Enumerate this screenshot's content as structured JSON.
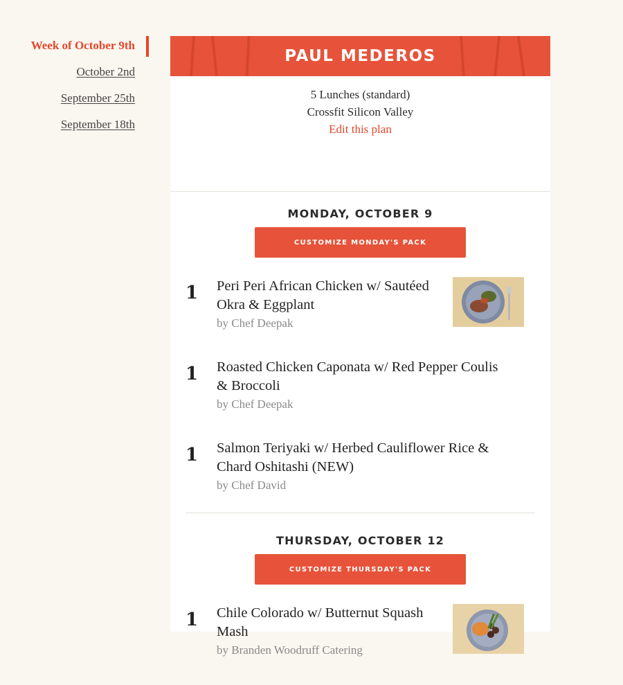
{
  "sidebar": {
    "weeks": [
      {
        "label": "Week of October 9th"
      },
      {
        "label": "October 2nd"
      },
      {
        "label": "September 25th"
      },
      {
        "label": "September 18th"
      }
    ]
  },
  "plan": {
    "customer_name": "PAUL MEDEROS",
    "lunches": "5 Lunches (standard)",
    "location": "Crossfit Silicon Valley",
    "edit_label": "Edit this plan"
  },
  "days": [
    {
      "title": "MONDAY, OCTOBER 9",
      "button_label": "CUSTOMIZE MONDAY'S PACK",
      "meals": [
        {
          "qty": "1",
          "name": "Peri Peri African Chicken w/ Sautéed Okra & Eggplant",
          "chef": "by Chef Deepak",
          "has_image": true
        },
        {
          "qty": "1",
          "name": "Roasted Chicken Caponata w/ Red Pepper Coulis & Broccoli",
          "chef": "by Chef Deepak",
          "has_image": false
        },
        {
          "qty": "1",
          "name": "Salmon Teriyaki w/ Herbed Cauliflower Rice & Chard Oshitashi (NEW)",
          "chef": "by Chef David",
          "has_image": false
        }
      ]
    },
    {
      "title": "THURSDAY, OCTOBER 12",
      "button_label": "CUSTOMIZE THURSDAY'S PACK",
      "meals": [
        {
          "qty": "1",
          "name": "Chile Colorado w/ Butternut Squash Mash",
          "chef": "by Branden Woodruff Catering",
          "has_image": true
        }
      ]
    }
  ],
  "colors": {
    "accent": "#e6533a",
    "link": "#e4472a",
    "background": "#faf6f0"
  }
}
